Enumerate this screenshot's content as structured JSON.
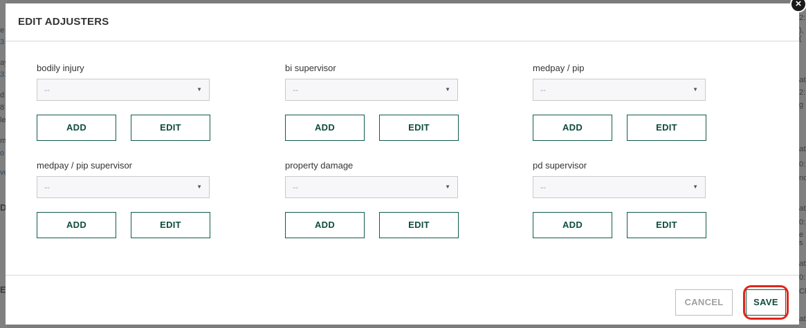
{
  "modal": {
    "title": "EDIT ADJUSTERS",
    "close_label": "×",
    "fields": [
      {
        "label": "bodily injury",
        "value": "--",
        "add": "ADD",
        "edit": "EDIT"
      },
      {
        "label": "bi supervisor",
        "value": "--",
        "add": "ADD",
        "edit": "EDIT"
      },
      {
        "label": "medpay / pip",
        "value": "--",
        "add": "ADD",
        "edit": "EDIT"
      },
      {
        "label": "medpay / pip supervisor",
        "value": "--",
        "add": "ADD",
        "edit": "EDIT"
      },
      {
        "label": "property damage",
        "value": "--",
        "add": "ADD",
        "edit": "EDIT"
      },
      {
        "label": "pd supervisor",
        "value": "--",
        "add": "ADD",
        "edit": "EDIT"
      }
    ],
    "footer": {
      "cancel_label": "CANCEL",
      "save_label": "SAVE"
    }
  },
  "background": {
    "left_fragments": [
      "e",
      "3",
      "ay",
      "31",
      "d",
      "8",
      "le",
      "m",
      "o",
      "ve",
      "D",
      "E"
    ],
    "right_fragments": [
      "2:",
      "),(",
      "ati",
      "2:",
      "g",
      "ati",
      "0:",
      "nd",
      "ati",
      "0:",
      "e s",
      "ati",
      "0:",
      "Cl",
      "ati"
    ]
  }
}
